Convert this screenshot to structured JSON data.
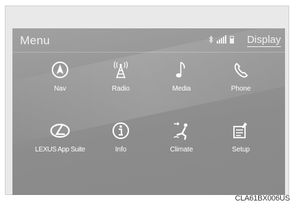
{
  "header": {
    "title": "Menu",
    "display_label": "Display",
    "status_icons": [
      "bluetooth-icon",
      "signal-icon",
      "battery-icon"
    ]
  },
  "tiles": [
    {
      "label": "Nav",
      "icon": "navigation-icon"
    },
    {
      "label": "Radio",
      "icon": "radio-tower-icon"
    },
    {
      "label": "Media",
      "icon": "music-note-icon"
    },
    {
      "label": "Phone",
      "icon": "phone-icon"
    },
    {
      "label": "LEXUS App Suite",
      "icon": "lexus-logo-icon"
    },
    {
      "label": "Info",
      "icon": "info-icon"
    },
    {
      "label": "Climate",
      "icon": "seat-climate-icon"
    },
    {
      "label": "Setup",
      "icon": "setup-icon"
    }
  ],
  "caption": "CLA61BX006US",
  "colors": {
    "screen_background": "#939393",
    "text": "#ffffff",
    "frame": "#e9e9e9"
  }
}
